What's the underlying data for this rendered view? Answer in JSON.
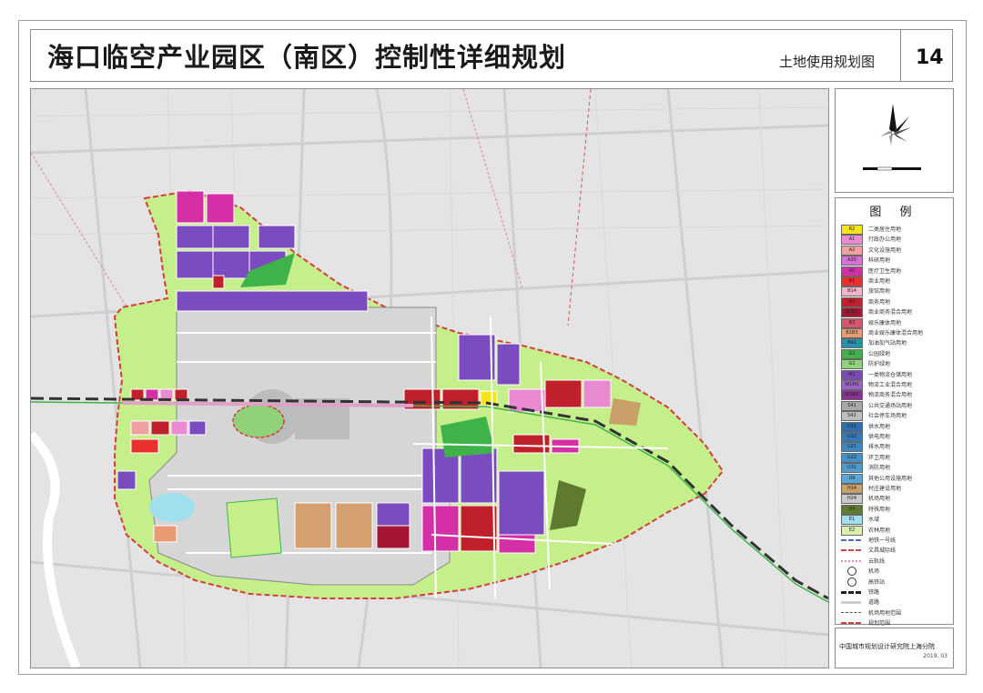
{
  "title": "海口临空产业园区（南区）控制性详细规划",
  "subtitle": "土地使用规划图",
  "sheet_number": "14",
  "legend_title": "图 例",
  "legend_items": [
    {
      "code": "R2",
      "label": "二类居住用地",
      "color": "#f5e31e"
    },
    {
      "code": "A1",
      "label": "行政办公用地",
      "color": "#e98ad2"
    },
    {
      "code": "A2",
      "label": "文化设施用地",
      "color": "#f0a0a0"
    },
    {
      "code": "A35",
      "label": "科研用地",
      "color": "#d76fd4"
    },
    {
      "code": "A5",
      "label": "医疗卫生用地",
      "color": "#d52fa8"
    },
    {
      "code": "B1",
      "label": "商业用地",
      "color": "#e8312c"
    },
    {
      "code": "B14",
      "label": "旅馆用地",
      "color": "#f2b2c8"
    },
    {
      "code": "B2",
      "label": "商务用地",
      "color": "#c0202c"
    },
    {
      "code": "B1B2",
      "label": "商业商务混合用地",
      "color": "#a41633"
    },
    {
      "code": "B3",
      "label": "娱乐康体用地",
      "color": "#d8566b"
    },
    {
      "code": "B1B3",
      "label": "商业娱乐康体混合用地",
      "color": "#e89a74"
    },
    {
      "code": "B41",
      "label": "加油加气站用地",
      "color": "#2a8fa8"
    },
    {
      "code": "G1",
      "label": "公园绿地",
      "color": "#44b04c"
    },
    {
      "code": "G2",
      "label": "防护绿地",
      "color": "#8fd27a"
    },
    {
      "code": "M1",
      "label": "一类物流仓储用地",
      "color": "#7a4bb5"
    },
    {
      "code": "W1M1",
      "label": "物流工业混合用地",
      "color": "#9b62c8"
    },
    {
      "code": "W1B2",
      "label": "物流商务混合用地",
      "color": "#8b2f95"
    },
    {
      "code": "S41",
      "label": "公共交通场站用地",
      "color": "#a8a8a8"
    },
    {
      "code": "S42",
      "label": "社会停车场用地",
      "color": "#bdbdbd"
    },
    {
      "code": "U11",
      "label": "供水用地",
      "color": "#2c6eb0"
    },
    {
      "code": "U12",
      "label": "供电用地",
      "color": "#3378bb"
    },
    {
      "code": "U21",
      "label": "排水用地",
      "color": "#3c86c2"
    },
    {
      "code": "U22",
      "label": "环卫用地",
      "color": "#4691c8"
    },
    {
      "code": "U31",
      "label": "消防用地",
      "color": "#4f9bce"
    },
    {
      "code": "U9",
      "label": "其他公用设施用地",
      "color": "#5aa6d4"
    },
    {
      "code": "H14",
      "label": "村庄建设用地",
      "color": "#caa06a"
    },
    {
      "code": "H24",
      "label": "机场用地",
      "color": "#c9c9c9"
    },
    {
      "code": "H4",
      "label": "特殊用地",
      "color": "#5f7a2e"
    },
    {
      "code": "E1",
      "label": "水域",
      "color": "#9fe0ec"
    },
    {
      "code": "E2",
      "label": "农林用地",
      "color": "#d6eeb0"
    }
  ],
  "legend_line_items": [
    {
      "label": "地铁一号线",
      "style": "dashed-blue"
    },
    {
      "label": "文昌城际线",
      "style": "dashed-red"
    },
    {
      "label": "云轨线",
      "style": "dotted-pink"
    },
    {
      "label": "机场",
      "style": "symbol"
    },
    {
      "label": "高铁站",
      "style": "symbol"
    },
    {
      "label": "铁路",
      "style": "rail"
    },
    {
      "label": "道路",
      "style": "road"
    },
    {
      "label": "机场用地范围",
      "style": "dash-dark"
    },
    {
      "label": "规划范围",
      "style": "dashed-boundary"
    }
  ],
  "credit": "中国城市规划设计研究院上海分院",
  "credit_date": "2019. 03",
  "colors": {
    "boundary": "#d53c3c",
    "protective_green": "#c4ef8a",
    "park_green": "#3fb24a",
    "logistics": "#7b4cc0",
    "airport": "#d6d6d6",
    "base_map": "#e4e4e4"
  }
}
